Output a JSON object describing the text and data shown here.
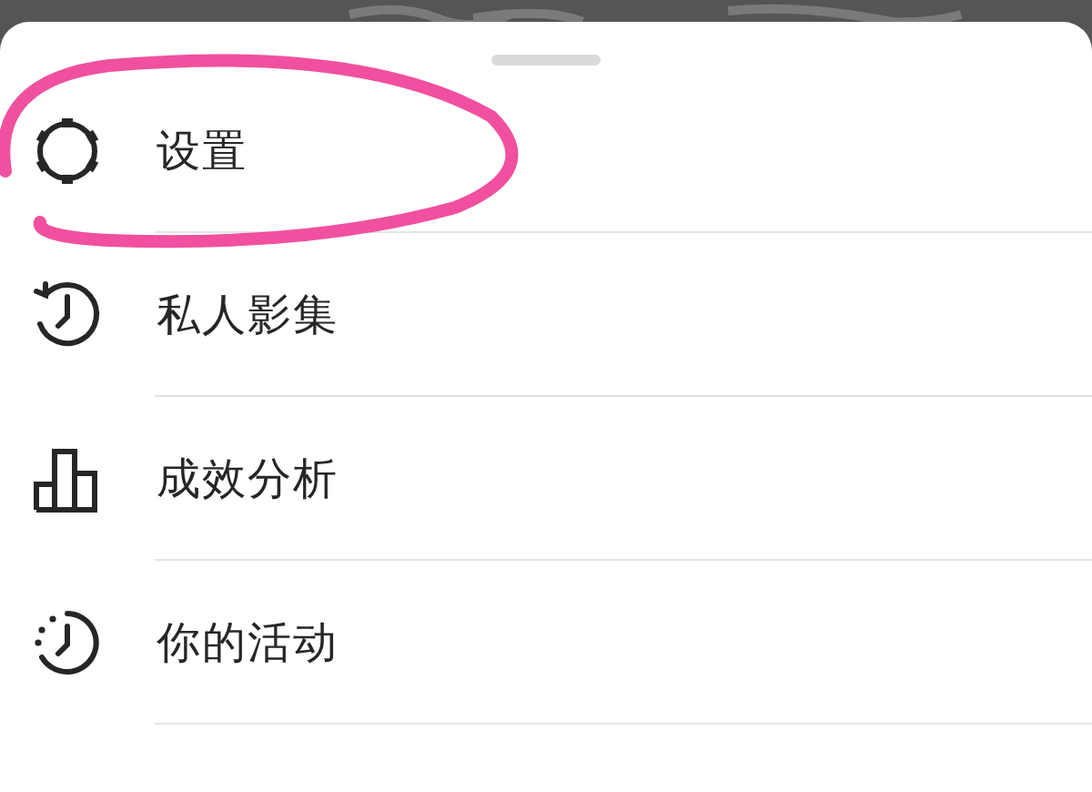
{
  "menu_items": [
    {
      "kind": "gear",
      "label": "设置",
      "highlighted": true
    },
    {
      "kind": "history",
      "label": "私人影集",
      "highlighted": false
    },
    {
      "kind": "chart",
      "label": "成效分析",
      "highlighted": false
    },
    {
      "kind": "activity",
      "label": "你的活动",
      "highlighted": false
    }
  ]
}
